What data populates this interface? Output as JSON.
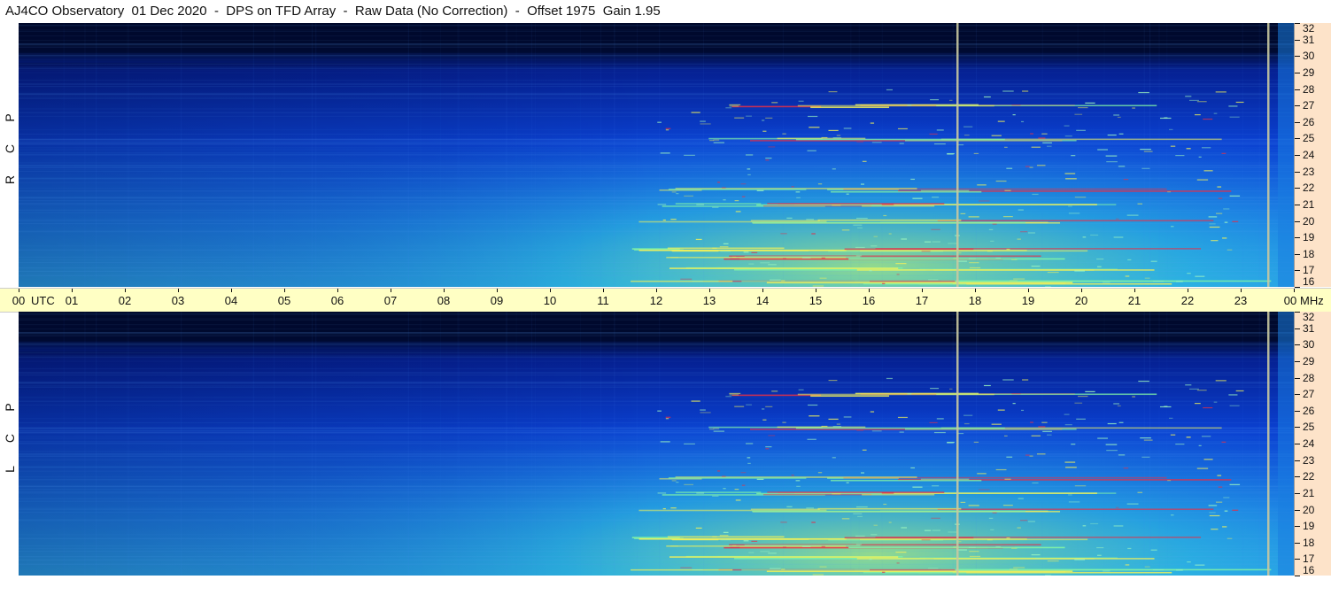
{
  "title": "AJ4CO Observatory  01 Dec 2020  -  DPS on TFD Array  -  Raw Data (No Correction)  -  Offset 1975  Gain 1.95",
  "panels": [
    {
      "label_letters": [
        "R",
        "C",
        "P"
      ]
    },
    {
      "label_letters": [
        "L",
        "C",
        "P"
      ]
    }
  ],
  "time_axis": {
    "utc_label": "UTC",
    "mhz_label": "MHz",
    "ticks": [
      "00",
      "01",
      "02",
      "03",
      "04",
      "05",
      "06",
      "07",
      "08",
      "09",
      "10",
      "11",
      "12",
      "13",
      "14",
      "15",
      "16",
      "17",
      "18",
      "19",
      "20",
      "21",
      "22",
      "23",
      "00"
    ]
  },
  "freq_axis": {
    "ticks": [
      "16",
      "17",
      "18",
      "19",
      "20",
      "21",
      "22",
      "23",
      "24",
      "25",
      "26",
      "27",
      "28",
      "29",
      "30",
      "31",
      "32"
    ]
  },
  "colors": {
    "time_axis_bg": "#ffffc4",
    "freq_axis_bg": "#fde3c9",
    "cold": "#000a30",
    "mid": "#0a40d0",
    "warm": "#2aa0ea",
    "hot_yellow": "#f0f05a",
    "hot_red": "#e0304a",
    "marker_line": "#c8c8a0"
  },
  "chart_data": [
    {
      "type": "heatmap",
      "title": "R C P",
      "x": [
        "00",
        "01",
        "02",
        "03",
        "04",
        "05",
        "06",
        "07",
        "08",
        "09",
        "10",
        "11",
        "12",
        "13",
        "14",
        "15",
        "16",
        "17",
        "18",
        "19",
        "20",
        "21",
        "22",
        "23",
        "00"
      ],
      "xlabel": "UTC",
      "ylabel": "MHz",
      "ylim": [
        16,
        32
      ],
      "markers_utc": [
        17.65,
        23.5
      ],
      "signal_bands_mhz": [
        27,
        25,
        21.9,
        21,
        20,
        18.3,
        17.8,
        17.1,
        16.3
      ]
    },
    {
      "type": "heatmap",
      "title": "L C P",
      "x": [
        "00",
        "01",
        "02",
        "03",
        "04",
        "05",
        "06",
        "07",
        "08",
        "09",
        "10",
        "11",
        "12",
        "13",
        "14",
        "15",
        "16",
        "17",
        "18",
        "19",
        "20",
        "21",
        "22",
        "23",
        "00"
      ],
      "xlabel": "UTC",
      "ylabel": "MHz",
      "ylim": [
        16,
        32
      ],
      "markers_utc": [
        17.65,
        23.5
      ],
      "signal_bands_mhz": [
        27,
        25,
        21.9,
        21,
        20,
        18.3,
        17.8,
        17.1,
        16.3
      ]
    }
  ]
}
